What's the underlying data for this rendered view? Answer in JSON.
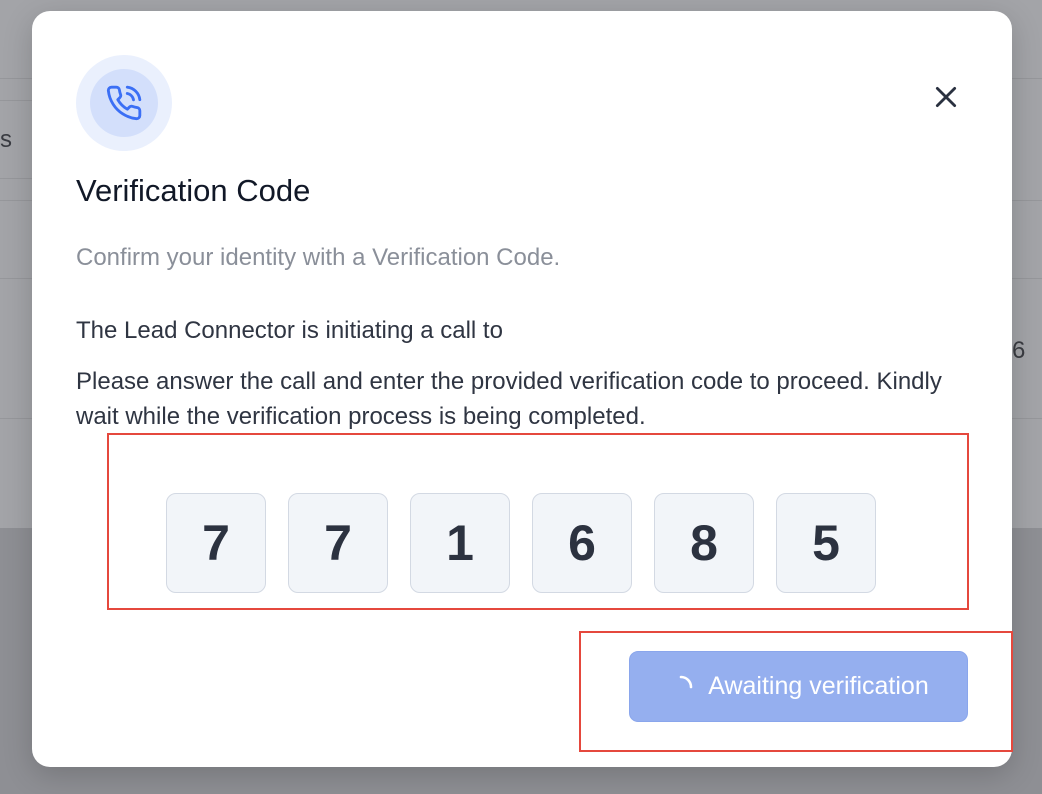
{
  "background": {
    "fragment_left": "s",
    "fragment_right": "6"
  },
  "dialog": {
    "icon": "phone-call-icon",
    "close_icon": "close-icon",
    "title": "Verification Code",
    "subtitle": "Confirm your identity with a Verification Code.",
    "call_notice": "The Lead Connector is initiating a call to",
    "instructions": "Please answer the call and enter the provided verification code to proceed. Kindly wait while the verification process is being completed.",
    "code_digits": [
      "7",
      "7",
      "1",
      "6",
      "8",
      "5"
    ],
    "button_label": "Awaiting verification",
    "button_icon": "loading-spinner-icon"
  },
  "colors": {
    "accent": "#3b6ff5",
    "button_disabled": "#95afef",
    "annotation": "#e5483d"
  }
}
